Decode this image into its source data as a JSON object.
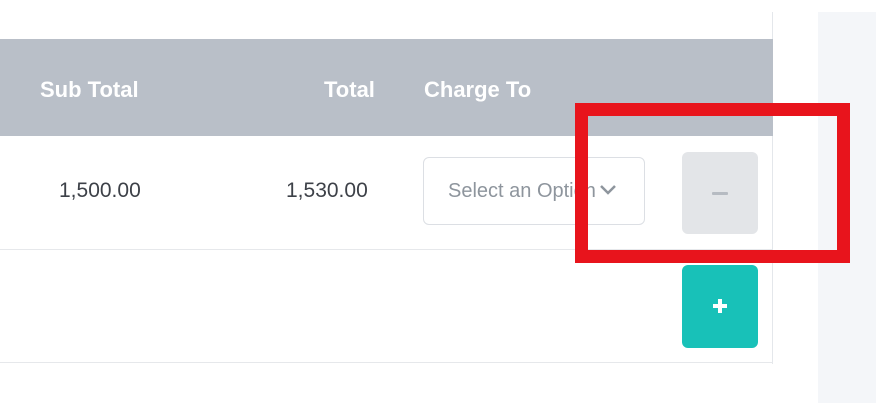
{
  "table": {
    "headers": {
      "sub_total": "Sub Total",
      "total": "Total",
      "charge_to": "Charge To"
    },
    "rows": [
      {
        "sub_total": "1,500.00",
        "total": "1,530.00",
        "charge_to_placeholder": "Select an Option"
      }
    ]
  },
  "buttons": {
    "remove_row": "−",
    "add_row": "+"
  },
  "icons": {
    "select_caret": "chevron-down-icon",
    "remove": "minus-icon",
    "add": "plus-icon"
  },
  "colors": {
    "header_bg": "#b9bfc8",
    "add_button": "#18c1b8",
    "remove_button": "#e3e5e8",
    "annotation": "#e8141c"
  }
}
